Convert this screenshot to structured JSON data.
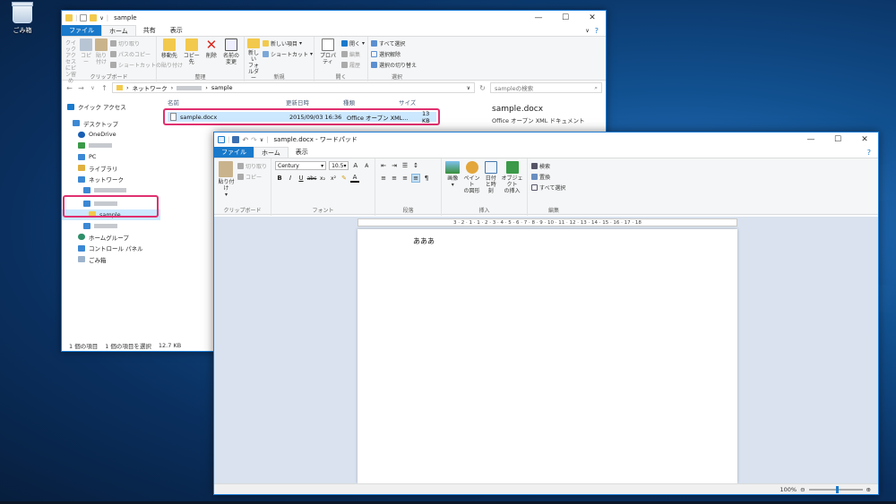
{
  "colors": {
    "accent": "#1979ca",
    "highlight": "#e0306f",
    "selection": "#cce8ff"
  },
  "desktop": {
    "recycle_label": "ごみ箱"
  },
  "explorer": {
    "title": "sample",
    "tabs": [
      "ファイル",
      "ホーム",
      "共有",
      "表示"
    ],
    "ribbon": {
      "clipboard": {
        "pin": "クイック アクセス\nにピン留め",
        "copy": "コピー",
        "paste": "貼り付け",
        "cut": "切り取り",
        "copy_path": "パスのコピー",
        "paste_shortcut": "ショートカットの貼り付け",
        "label": "クリップボード"
      },
      "organize": {
        "move_to": "移動先",
        "copy_to": "コピー先",
        "delete": "削除",
        "rename": "名前の\n変更",
        "label": "整理"
      },
      "new": {
        "new_folder": "新しい\nフォルダー",
        "new_item": "新しい項目",
        "shortcut": "ショートカット",
        "label": "新規"
      },
      "open": {
        "properties": "プロパティ",
        "open": "開く",
        "edit": "編集",
        "history": "履歴",
        "label": "開く"
      },
      "select": {
        "select_all": "すべて選択",
        "select_none": "選択解除",
        "invert": "選択の切り替え",
        "label": "選択"
      }
    },
    "address": {
      "network": "ネットワーク",
      "folder": "sample"
    },
    "search_placeholder": "sampleの検索",
    "nav": {
      "quick_access": "クイック アクセス",
      "desktop": "デスクトップ",
      "onedrive": "OneDrive",
      "pc": "PC",
      "library": "ライブラリ",
      "network": "ネットワーク",
      "sample": "sample",
      "homegroup": "ホームグループ",
      "control_panel": "コントロール パネル",
      "recycle": "ごみ箱"
    },
    "columns": {
      "name": "名前",
      "modified": "更新日時",
      "type": "種類",
      "size": "サイズ"
    },
    "file": {
      "name": "sample.docx",
      "modified": "2015/09/03 16:36",
      "type": "Office オープン XML...",
      "size": "13 KB"
    },
    "preview": {
      "name": "sample.docx",
      "type": "Office オープン XML ドキュメント"
    },
    "status": {
      "items": "1 個の項目",
      "selected": "1 個の項目を選択",
      "size": "12.7 KB"
    }
  },
  "wordpad": {
    "title": "sample.docx - ワードパッド",
    "tabs": [
      "ファイル",
      "ホーム",
      "表示"
    ],
    "ribbon": {
      "clipboard": {
        "paste": "貼り付け",
        "cut": "切り取り",
        "copy": "コピー",
        "label": "クリップボード"
      },
      "font": {
        "family": "Century",
        "size": "10.5",
        "label": "フォント"
      },
      "paragraph": {
        "label": "段落"
      },
      "insert": {
        "picture": "画像",
        "paint": "ペイント\nの図形",
        "datetime": "日付\nと時刻",
        "object": "オブジェクト\nの挿入",
        "label": "挿入"
      },
      "edit": {
        "find": "検索",
        "replace": "置換",
        "select_all": "すべて選択",
        "label": "編集"
      }
    },
    "ruler": "3 · 2 · 1 · 1 · 2 · 3 · 4 · 5 · 6 · 7 · 8 · 9 · 10 · 11 · 12 · 13 · 14 · 15 · 16 · 17 · 18",
    "document_text": "あああ",
    "zoom": {
      "label": "100%",
      "value": 50
    }
  }
}
